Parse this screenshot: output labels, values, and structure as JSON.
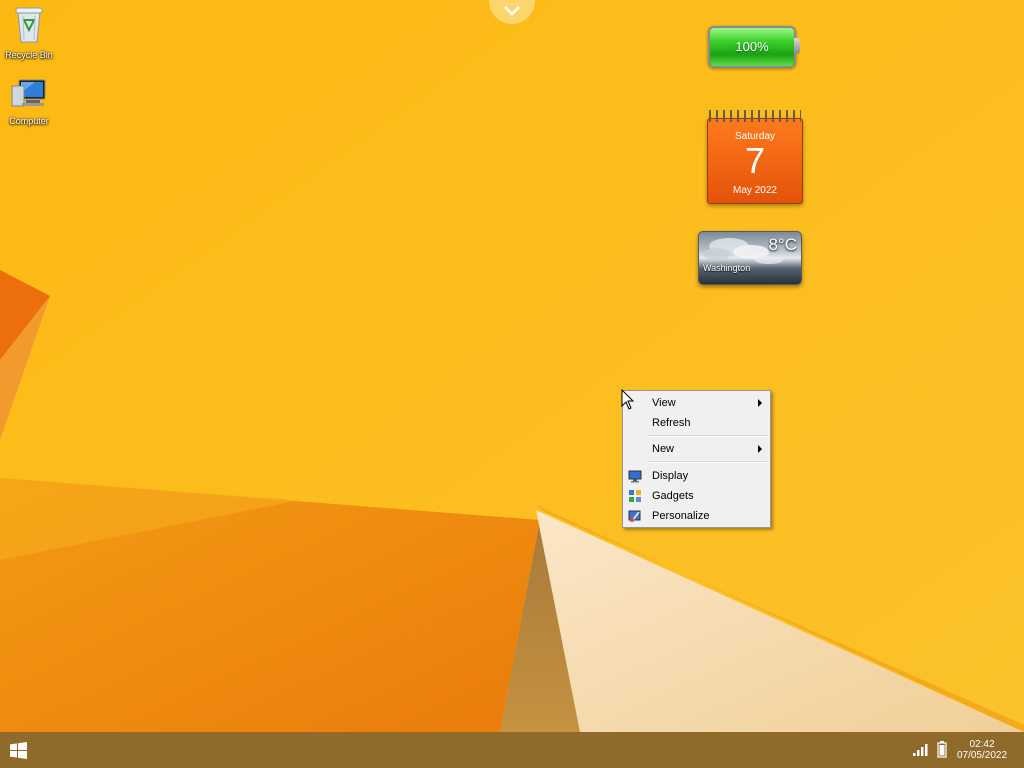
{
  "desktop": {
    "icons": [
      {
        "label": "Recycle Bin",
        "icon": "recycle-bin-icon"
      },
      {
        "label": "Computer",
        "icon": "computer-icon"
      }
    ]
  },
  "gadgets": {
    "battery": {
      "percent_label": "100%",
      "level": 1.0,
      "color": "#2dbf1f"
    },
    "calendar": {
      "weekday": "Saturday",
      "day": "7",
      "month_year": "May 2022",
      "color": "#f26a13"
    },
    "weather": {
      "temperature": "8°C",
      "city": "Washington"
    }
  },
  "context_menu": {
    "items": [
      {
        "label": "View",
        "has_submenu": true
      },
      {
        "label": "Refresh",
        "has_submenu": false
      },
      {
        "label": "New",
        "has_submenu": true
      },
      {
        "label": "Display",
        "icon": "display-icon"
      },
      {
        "label": "Gadgets",
        "icon": "gadgets-icon"
      },
      {
        "label": "Personalize",
        "icon": "personalize-icon"
      }
    ]
  },
  "taskbar": {
    "start_icon": "windows-logo-icon",
    "clock": {
      "time": "02:42",
      "date": "07/05/2022"
    },
    "tray_icons": [
      "network-signal-icon",
      "battery-icon"
    ]
  },
  "theme": {
    "wallpaper_color": "#fbb814",
    "taskbar_color": "#8a672c"
  }
}
